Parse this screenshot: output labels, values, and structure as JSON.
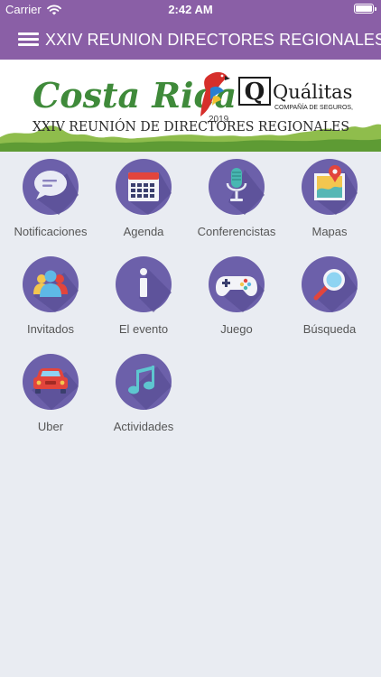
{
  "status_bar": {
    "carrier": "Carrier",
    "time": "2:42 AM"
  },
  "nav": {
    "title": "XXIV REUNION DIRECTORES REGIONALES"
  },
  "banner": {
    "brand": "Costa Rica",
    "year": "2019",
    "sponsor_letter": "Q",
    "sponsor_name": "Quálitas",
    "sponsor_subtitle": "COMPAÑÍA DE SEGUROS,",
    "event_title": "XXIV REUNIÓN DE DIRECTORES REGIONALES"
  },
  "menu_items": [
    {
      "label": "Notificaciones",
      "icon": "speech-bubble-icon"
    },
    {
      "label": "Agenda",
      "icon": "calendar-icon"
    },
    {
      "label": "Conferencistas",
      "icon": "microphone-icon"
    },
    {
      "label": "Mapas",
      "icon": "map-pin-icon"
    },
    {
      "label": "Invitados",
      "icon": "people-icon"
    },
    {
      "label": "El evento",
      "icon": "info-icon"
    },
    {
      "label": "Juego",
      "icon": "gamepad-icon"
    },
    {
      "label": "Búsqueda",
      "icon": "magnifier-icon"
    },
    {
      "label": "Uber",
      "icon": "car-icon"
    },
    {
      "label": "Actividades",
      "icon": "music-note-icon"
    }
  ],
  "colors": {
    "header": "#8a5fa6",
    "icon_circle": "#6c60aa",
    "background": "#e9ecf2",
    "label": "#555555"
  }
}
